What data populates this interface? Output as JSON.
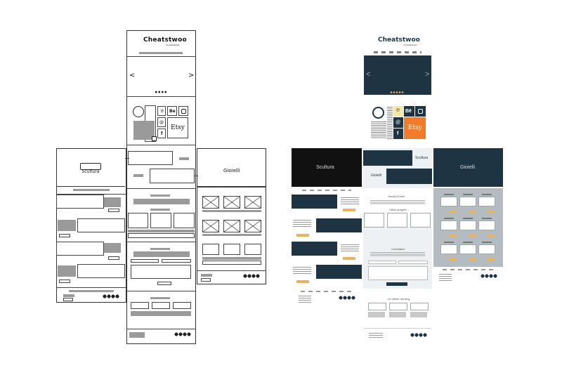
{
  "wireframe": {
    "logo_text": "Cheatstwoo",
    "logo_tagline": "Curosotempo",
    "prev_arrow": "<",
    "next_arrow": ">",
    "social_be": "Be",
    "social_etsy": "Etsy",
    "scultura_label": "Scultura",
    "gioielli_label": "Gioielli"
  },
  "mockup": {
    "logo_text": "Cheatstwoo",
    "logo_tagline": "Curosotempo",
    "prev_arrow": "<",
    "next_arrow": ">",
    "social_be": "Bē",
    "social_etsy": "Etsy",
    "scultura_title": "Scultura",
    "gioielli_title": "Gioielli",
    "scultura_tile": "Scultura",
    "gioielli_tile": "Gioielli",
    "author_name": "Sandra Ennie",
    "works_heading": "Ultimi progetti",
    "contact_heading": "Contattami",
    "blog_heading": "Le ultime dal blog"
  },
  "colors": {
    "mockup_dark": "#1f3442",
    "mockup_black": "#111111",
    "mockup_gray": "#b4bcc2",
    "mockup_light": "#eef1f3",
    "accent_orange": "#e8b460",
    "etsy_orange": "#f07b2a",
    "pinterest_yellow": "#f3e8a8"
  }
}
